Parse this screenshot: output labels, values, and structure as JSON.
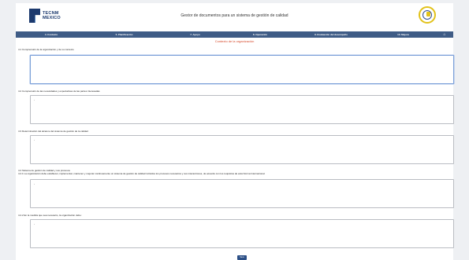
{
  "header": {
    "logo_line1": "TECNM",
    "logo_line2": "MEXICO",
    "app_title": "Gestor de documentos para un sistema de gestión de calidad"
  },
  "nav": {
    "items": [
      {
        "label": "4. Contexto"
      },
      {
        "label": "5. Planificación"
      },
      {
        "label": "7. Apoyo"
      },
      {
        "label": "8. Operación"
      },
      {
        "label": "9. Evaluación del desempeño"
      },
      {
        "label": "10. Mejora"
      }
    ],
    "home_icon": "home-icon"
  },
  "section_title": "Contexto de la organización",
  "questions": [
    {
      "label": "4.1 Comprensión de la organización y de su contexto",
      "value": ""
    },
    {
      "label": "4.2 Comprensión de las necesidades y expectativas de las partes interesadas",
      "value": "-"
    },
    {
      "label": "4.3 Determinación del alcance del sistema de gestión de la calidad",
      "value": "-"
    },
    {
      "label": "4.4 Sistema de gestión de calidad y sus procesos",
      "sublabel": "4.4.1 La organización debe establecer, implementar, mantener y mejorar continuamente un sistema de gestión de calidad incluidos los procesos necesarios y sus interacciones, de acuerdo con los requisitos de esta Norma Internacional.",
      "value": "-"
    },
    {
      "label": "4.4.2 En la medida que sea necesario, la organización debe:",
      "value": "-"
    }
  ],
  "save_label": "Save",
  "colors": {
    "nav_bg": "#3f5c86",
    "section_title": "#d64a2c",
    "button_bg": "#2c4f86"
  }
}
